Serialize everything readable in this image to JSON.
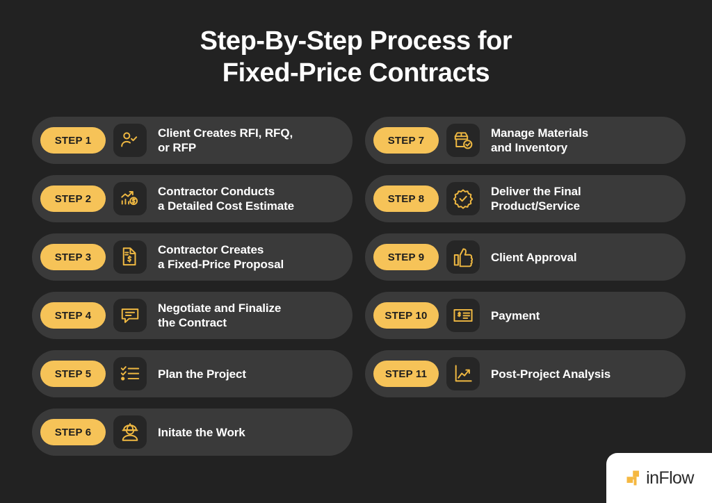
{
  "title": {
    "line1": "Step-By-Step Process for",
    "line2": "Fixed-Price Contracts"
  },
  "colors": {
    "background": "#222222",
    "card": "#3a3a3a",
    "pill": "#f6c358",
    "icon_tile": "#262626",
    "icon_stroke": "#f0b942",
    "title_text": "#ffffff",
    "pill_text": "#1d1d1d",
    "logo_accent": "#f5b841"
  },
  "columns": [
    {
      "steps": [
        {
          "badge": "STEP 1",
          "label": "Client Creates RFI, RFQ,\nor RFP",
          "icon": "user-check-icon"
        },
        {
          "badge": "STEP 2",
          "label": "Contractor Conducts\na Detailed Cost Estimate",
          "icon": "cost-estimate-chart-icon"
        },
        {
          "badge": "STEP 3",
          "label": "Contractor Creates\na Fixed-Price Proposal",
          "icon": "document-dollar-icon"
        },
        {
          "badge": "STEP 4",
          "label": "Negotiate and Finalize\nthe Contract",
          "icon": "chat-bubble-icon"
        },
        {
          "badge": "STEP 5",
          "label": "Plan the Project",
          "icon": "checklist-icon"
        },
        {
          "badge": "STEP 6",
          "label": "Initate the Work",
          "icon": "worker-hardhat-icon"
        }
      ]
    },
    {
      "steps": [
        {
          "badge": "STEP 7",
          "label": "Manage Materials\nand Inventory",
          "icon": "box-check-icon"
        },
        {
          "badge": "STEP 8",
          "label": "Deliver the Final\nProduct/Service",
          "icon": "badge-check-icon"
        },
        {
          "badge": "STEP 9",
          "label": "Client Approval",
          "icon": "thumbs-up-icon"
        },
        {
          "badge": "STEP 10",
          "label": "Payment",
          "icon": "invoice-dollar-icon"
        },
        {
          "badge": "STEP 11",
          "label": "Post-Project Analysis",
          "icon": "line-chart-icon"
        }
      ]
    }
  ],
  "logo": {
    "text": "inFlow",
    "mark": "inflow-logo-mark"
  }
}
